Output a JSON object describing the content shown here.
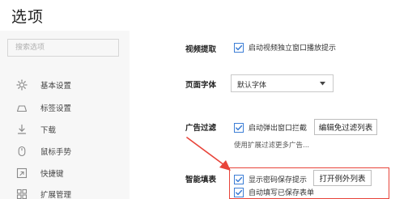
{
  "page": {
    "title": "选项"
  },
  "sidebar": {
    "search_placeholder": "搜索选项",
    "items": [
      {
        "label": "基本设置",
        "icon": "gear-icon"
      },
      {
        "label": "标签设置",
        "icon": "tab-icon"
      },
      {
        "label": "下载",
        "icon": "download-icon"
      },
      {
        "label": "鼠标手势",
        "icon": "mouse-icon"
      },
      {
        "label": "快捷键",
        "icon": "shortcut-icon"
      },
      {
        "label": "扩展管理",
        "icon": "extension-icon"
      }
    ]
  },
  "settings": {
    "video": {
      "label": "视频提取",
      "checkbox_label": "启动视频独立窗口播放提示",
      "checked": true
    },
    "font": {
      "label": "页面字体",
      "selected": "默认字体"
    },
    "ad_filter": {
      "label": "广告过滤",
      "checkbox_label": "启动弹出窗口拦截",
      "checked": true,
      "button_label": "编辑免过滤列表",
      "hint": "使用扩展过滤更多广告..."
    },
    "autofill": {
      "label": "智能填表",
      "show_password_label": "显示密码保存提示",
      "show_password_checked": true,
      "button_label": "打开例外列表",
      "autofill_label": "自动填写已保存表单",
      "autofill_checked": true
    }
  },
  "colors": {
    "accent": "#3c7ed6",
    "annotation": "#e8443a",
    "sidebar_bg": "#f7f7f7"
  }
}
